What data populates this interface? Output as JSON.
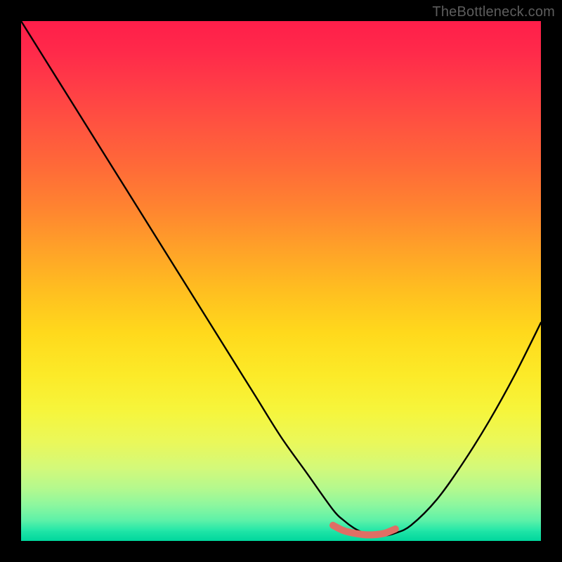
{
  "watermark": "TheBottleneck.com",
  "chart_data": {
    "type": "line",
    "title": "",
    "xlabel": "",
    "ylabel": "",
    "xlim": [
      0,
      100
    ],
    "ylim": [
      0,
      100
    ],
    "grid": false,
    "series": [
      {
        "name": "bottleneck-curve",
        "color": "#000000",
        "x": [
          0,
          5,
          10,
          15,
          20,
          25,
          30,
          35,
          40,
          45,
          50,
          55,
          60,
          62,
          64,
          66,
          68,
          70,
          72,
          75,
          80,
          85,
          90,
          95,
          100
        ],
        "values": [
          100,
          92,
          84,
          76,
          68,
          60,
          52,
          44,
          36,
          28,
          20,
          13,
          6,
          4,
          2.5,
          1.5,
          1,
          1,
          1.5,
          3,
          8,
          15,
          23,
          32,
          42
        ]
      },
      {
        "name": "optimal-range-marker",
        "color": "#e07066",
        "x": [
          60,
          62,
          64,
          66,
          68,
          70,
          72
        ],
        "values": [
          3,
          2,
          1.5,
          1.2,
          1.2,
          1.5,
          2.3
        ]
      }
    ],
    "gradient_stops": [
      {
        "pos": 0,
        "color": "#ff1e4a"
      },
      {
        "pos": 12,
        "color": "#ff3b47"
      },
      {
        "pos": 28,
        "color": "#ff6a38"
      },
      {
        "pos": 44,
        "color": "#ffa228"
      },
      {
        "pos": 60,
        "color": "#ffd91c"
      },
      {
        "pos": 75,
        "color": "#f6f53c"
      },
      {
        "pos": 86,
        "color": "#d3f97a"
      },
      {
        "pos": 93,
        "color": "#8ef79e"
      },
      {
        "pos": 100,
        "color": "#00dba0"
      }
    ]
  }
}
